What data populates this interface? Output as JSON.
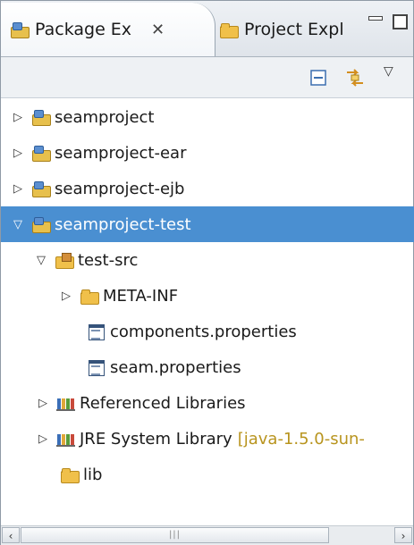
{
  "tabs": [
    {
      "label": "Package Ex",
      "icon": "package-explorer-icon",
      "close": "✕",
      "active": true
    },
    {
      "label": "Project Expl",
      "icon": "project-explorer-icon",
      "active": false
    }
  ],
  "view_controls": {
    "minimize": "minimize-icon",
    "maximize": "maximize-icon"
  },
  "toolbar": {
    "collapse_all_icon": "collapse-all-icon",
    "link_with_editor_icon": "link-with-editor-icon",
    "view_menu_icon": "view-menu-icon",
    "view_menu_glyph": "▽"
  },
  "tree": [
    {
      "name": "seamproject",
      "icon": "java-project-icon",
      "expanded": false
    },
    {
      "name": "seamproject-ear",
      "icon": "ear-project-icon",
      "expanded": false
    },
    {
      "name": "seamproject-ejb",
      "icon": "ejb-project-icon",
      "expanded": false
    },
    {
      "name": "seamproject-test",
      "icon": "java-project-icon",
      "expanded": true,
      "selected": true
    },
    {
      "name": "test-src",
      "icon": "source-folder-icon",
      "expanded": true
    },
    {
      "name": "META-INF",
      "icon": "folder-icon",
      "expanded": false
    },
    {
      "name": "components.properties",
      "icon": "properties-file-icon"
    },
    {
      "name": "seam.properties",
      "icon": "properties-file-icon"
    },
    {
      "name": "Referenced Libraries",
      "icon": "library-icon",
      "expanded": false
    },
    {
      "name": "JRE System Library",
      "decoration": "[java-1.5.0-sun-",
      "icon": "library-icon",
      "expanded": false
    },
    {
      "name": "lib",
      "icon": "folder-icon"
    }
  ],
  "glyphs": {
    "collapsed": "▷",
    "expanded": "▽"
  },
  "colors": {
    "selection": "#4a8fd1",
    "decoration": "#b8941e",
    "folder": "#f0c04a"
  }
}
